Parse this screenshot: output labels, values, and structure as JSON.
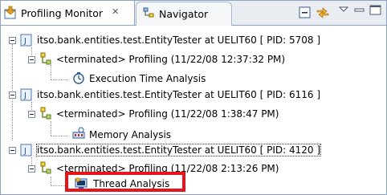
{
  "tabs": [
    {
      "label": "Profiling Monitor",
      "close": "✕",
      "icon": "profiling-monitor-icon"
    },
    {
      "label": "Navigator",
      "icon": "navigator-icon"
    }
  ],
  "toolbar_icons": [
    "collapse-all-icon",
    "link-with-editor-icon",
    "view-menu-icon",
    "minimize-icon",
    "maximize-icon"
  ],
  "tree": [
    {
      "label": "itso.bank.entities.test.EntityTester at UELIT60 [ PID: 5708 ]",
      "child": "<terminated> Profiling (11/22/08 12:37:32 PM)",
      "leaf": "Execution Time Analysis"
    },
    {
      "label": "itso.bank.entities.test.EntityTester at UELIT60 [ PID: 6116 ]",
      "child": "<terminated> Profiling (11/22/08 1:38:47 PM)",
      "leaf": "Memory Analysis"
    },
    {
      "label": "itso.bank.entities.test.EntityTester at UELIT60 [ PID: 4120 ]",
      "child": "<terminated> Profiling (11/22/08 2:13:26 PM)",
      "leaf": "Thread Analysis"
    }
  ],
  "colors": {
    "highlight": "#e8141b",
    "border": "#8da3c0"
  }
}
